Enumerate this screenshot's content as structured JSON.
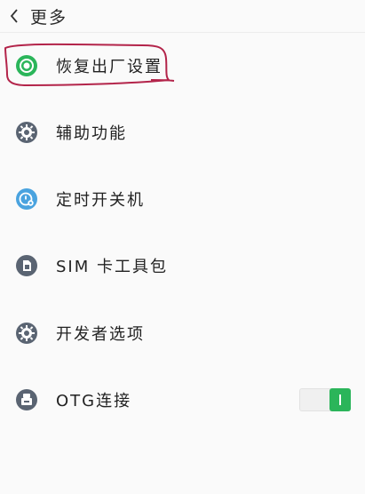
{
  "header": {
    "title": "更多"
  },
  "items": [
    {
      "label": "恢复出厂设置",
      "icon": "factory-reset-icon"
    },
    {
      "label": "辅助功能",
      "icon": "gear-icon"
    },
    {
      "label": "定时开关机",
      "icon": "timer-power-icon"
    },
    {
      "label": "SIM 卡工具包",
      "icon": "sim-card-icon"
    },
    {
      "label": "开发者选项",
      "icon": "gear-icon"
    },
    {
      "label": "OTG连接",
      "icon": "otg-icon"
    }
  ],
  "otg_toggle": {
    "enabled": true
  },
  "colors": {
    "accent_green": "#2bb55a",
    "icon_dark": "#5a6472",
    "icon_blue": "#4aa3df",
    "annotation_red": "#b3244a"
  }
}
